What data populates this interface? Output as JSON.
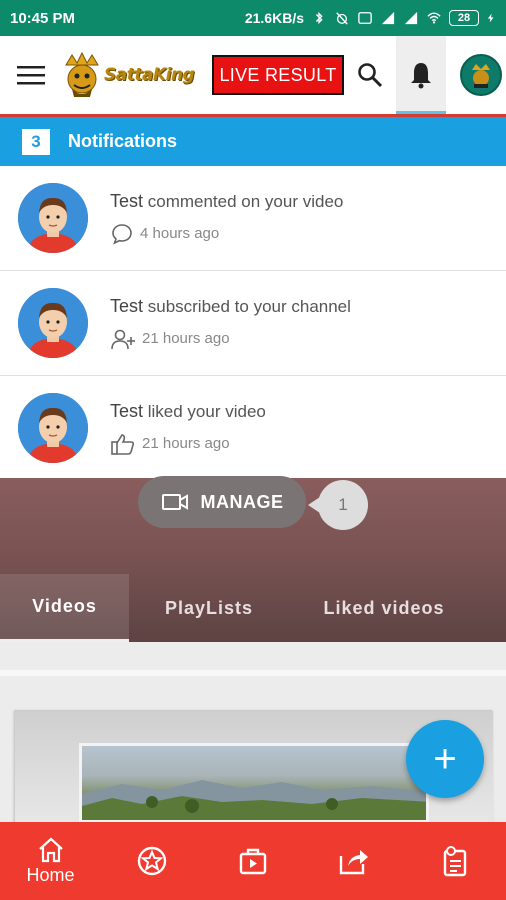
{
  "status": {
    "time": "10:45 PM",
    "speed": "21.6KB/s",
    "battery": "28"
  },
  "app_bar": {
    "logo_text": "SattaKing",
    "live_button": "LIVE RESULT"
  },
  "notifications": {
    "count": "3",
    "title": "Notifications",
    "items": [
      {
        "user": "Test",
        "action": " commented on your video",
        "time": "4 hours ago",
        "icon": "comment-icon"
      },
      {
        "user": "Test",
        "action": " subscribed to your channel",
        "time": "21 hours ago",
        "icon": "user-plus-icon"
      },
      {
        "user": "Test",
        "action": " liked your video",
        "time": "21 hours ago",
        "icon": "thumbs-up-icon"
      }
    ]
  },
  "channel": {
    "manage_label": "MANAGE",
    "manage_count": "1",
    "tabs": [
      "Videos",
      "PlayLists",
      "Liked videos"
    ],
    "active_tab": "Videos"
  },
  "fab_label": "+",
  "bottom_nav": {
    "home_label": "Home",
    "items": [
      "home-icon",
      "star-icon",
      "video-icon",
      "share-icon",
      "clipboard-icon"
    ]
  },
  "colors": {
    "status_bar": "#0d8a6a",
    "notif_header": "#1a9fe0",
    "live_button": "#e81212",
    "bottom_nav": "#ef3a2f",
    "fab": "#1a9fe0"
  }
}
